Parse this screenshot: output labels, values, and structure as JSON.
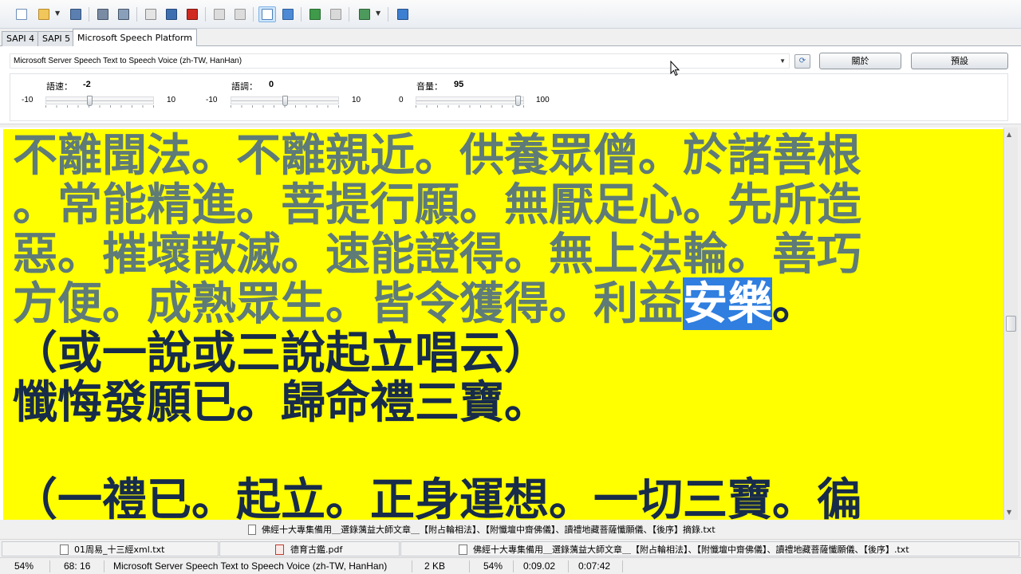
{
  "toolbar": {
    "icons": [
      "new-file-icon",
      "open-folder-icon",
      "open-dropdown-icon",
      "save-icon",
      "export-icon",
      "export-all-icon",
      "play-icon",
      "pause-icon",
      "stop-icon",
      "prev-sentence-icon",
      "next-sentence-icon",
      "view-text-icon",
      "view-bookmark-icon",
      "clipboard-monitor-icon",
      "clipboard-paste-icon",
      "audio-format-icon",
      "audio-format-dropdown-icon",
      "help-icon"
    ]
  },
  "tabs": [
    {
      "label": "SAPI 4"
    },
    {
      "label": "SAPI 5"
    },
    {
      "label": "Microsoft Speech Platform"
    }
  ],
  "voice": {
    "selected": "Microsoft Server Speech Text to Speech Voice (zh-TW, HanHan)",
    "about_label": "關於",
    "default_label": "預設"
  },
  "sliders": {
    "rate": {
      "label": "語速：",
      "value": "-2",
      "min": "-10",
      "max": "10",
      "fraction": 0.4
    },
    "pitch": {
      "label": "語調：",
      "value": "0",
      "min": "-10",
      "max": "10",
      "fraction": 0.5
    },
    "volume": {
      "label": "音量：",
      "value": "95",
      "min": "0",
      "max": "100",
      "fraction": 0.95
    }
  },
  "document": {
    "line1": "不離聞法。不離親近。供養眾僧。於諸善根",
    "line2": "。常能精進。菩提行願。無厭足心。先所造",
    "line3": "惡。摧壞散滅。速能證得。無上法輪。善巧",
    "line4_pre": "方便。成熟眾生。皆令獲得。利益",
    "line4_hl": "安樂",
    "line4_post": "。",
    "line5": "（或一說或三說起立唱云）",
    "line6": "懺悔發願已。歸命禮三寶。",
    "line7": "（一禮已。起立。正身運想。一切三寶。徧"
  },
  "path_bar": {
    "text": "佛經十大專集備用＿選錄蕅益大師文章＿【附占輪相法】、【附懺壇中齋佛儀】、讀禮地藏菩薩懺願儀、【後序】摘錄.txt"
  },
  "open_files": [
    {
      "name": "01周易_十三經xml.txt",
      "type": "txt"
    },
    {
      "name": "德育古鑑.pdf",
      "type": "pdf"
    },
    {
      "name": "佛經十大專集備用＿選錄蕅益大師文章＿【附占輪相法】、【附懺壇中齋佛儀】、讀禮地藏菩薩懺願儀、【後序】.txt",
      "type": "txt"
    }
  ],
  "status": {
    "zoom": "54%",
    "position": "68: 16",
    "voice": "Microsoft Server Speech Text to Speech Voice (zh-TW, HanHan)",
    "size": "2 KB",
    "progress": "54%",
    "elapsed": "0:09.02",
    "total": "0:07:42"
  },
  "colors": {
    "doc_background": "#ffff00",
    "spoken_text": "#5e7b78",
    "unspoken_text": "#172b4a",
    "highlight": "#2f7ee0"
  }
}
